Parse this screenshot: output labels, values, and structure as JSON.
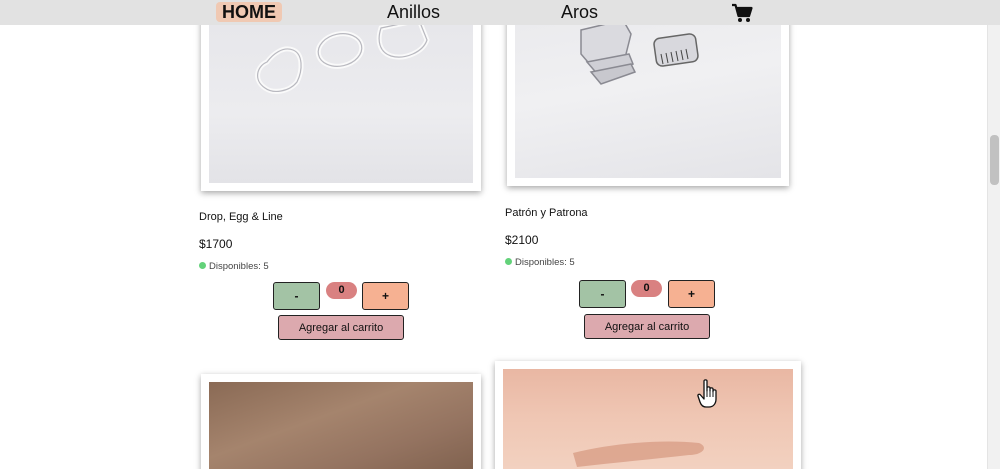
{
  "nav": {
    "home": "HOME",
    "anillos": "Anillos",
    "aros": "Aros",
    "cart_icon": "shopping-cart-icon"
  },
  "products": [
    {
      "name": "Drop, Egg & Line",
      "price": "$1700",
      "stock": "Disponibles: 5",
      "minus": "-",
      "quantity": "0",
      "plus": "+",
      "add_to_cart": "Agregar al carrito"
    },
    {
      "name": "Patrón y Patrona",
      "price": "$2100",
      "stock": "Disponibles: 5",
      "minus": "-",
      "quantity": "0",
      "plus": "+",
      "add_to_cart": "Agregar al carrito"
    }
  ],
  "colors": {
    "navbar": "#e2e2e2",
    "home_highlight": "#f0c9b3",
    "minus_button": "#a3c3a5",
    "plus_button": "#f6b192",
    "quantity_badge": "#d98181",
    "add_button": "#dca9ae",
    "stock_dot": "#63d27a"
  }
}
